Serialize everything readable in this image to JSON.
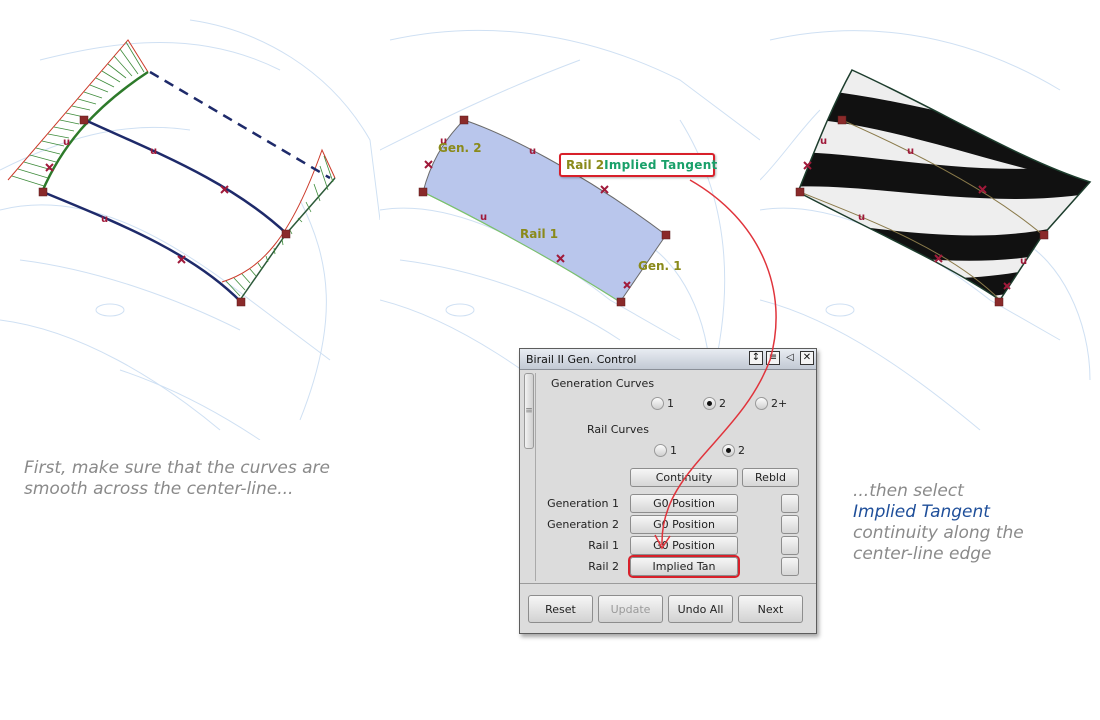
{
  "scenes": {
    "left": {
      "description": "wireframe car roof with curvature combs on generation curves and two rail curves"
    },
    "middle": {
      "labels": {
        "gen2": "Gen. 2",
        "rail1": "Rail 1",
        "gen1": "Gen. 1"
      },
      "surface_color": "#b9c6ec"
    },
    "right": {
      "description": "zebra stripe evaluation of the birail surface"
    }
  },
  "callout": {
    "part1": "Rail 2",
    "part2": "Implied  Tangent"
  },
  "captions": {
    "left": [
      "First, make sure that the curves are",
      "smooth across the center-line..."
    ],
    "right": {
      "line1": "...then select",
      "accent": "Implied Tangent",
      "line3": "continuity along the",
      "line4": "center-line edge"
    }
  },
  "dialog": {
    "title": "Birail II Gen. Control",
    "titlebar_icons": [
      "resize-icon",
      "menu-icon",
      "collapse-left-icon",
      "close-icon"
    ],
    "generation_curves": {
      "label": "Generation Curves",
      "options": [
        "1",
        "2",
        "2+"
      ],
      "selected": "2"
    },
    "rail_curves": {
      "label": "Rail Curves",
      "options": [
        "1",
        "2"
      ],
      "selected": "2"
    },
    "continuity_button": "Continuity",
    "rebuild_header": "Rebld",
    "rows": [
      {
        "label": "Generation 1",
        "value": "G0 Position"
      },
      {
        "label": "Generation 2",
        "value": "G0 Position"
      },
      {
        "label": "Rail 1",
        "value": "G0 Position"
      },
      {
        "label": "Rail 2",
        "value": "Implied Tan"
      }
    ],
    "footer": {
      "reset": "Reset",
      "update": "Update",
      "undo_all": "Undo All",
      "next": "Next"
    }
  },
  "colors": {
    "highlight": "#d8202a",
    "accent_text": "#1f4f9a",
    "callout_green": "#19a06a",
    "label_olive": "#8a8a1a"
  }
}
